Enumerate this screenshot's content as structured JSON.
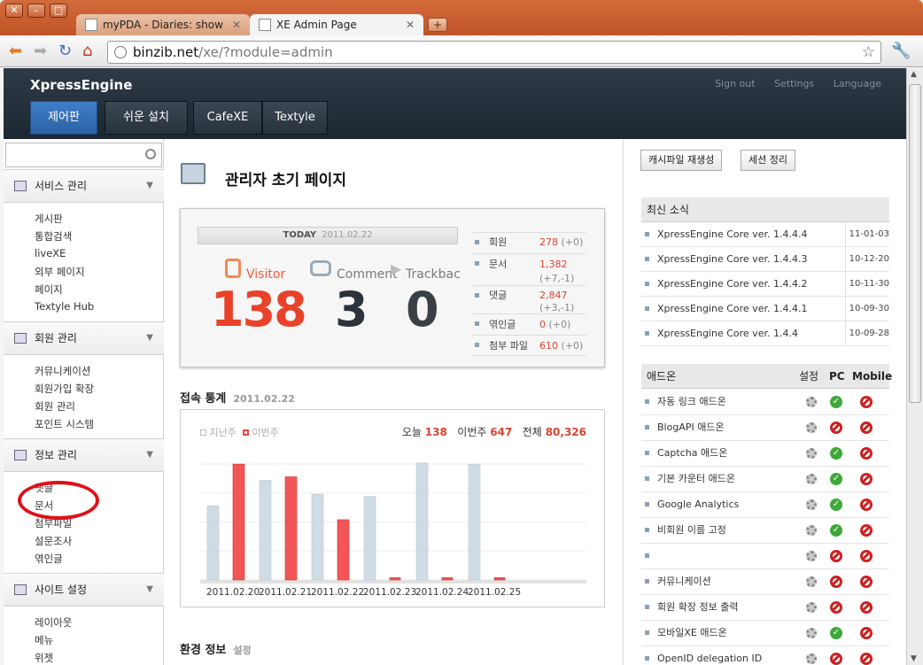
{
  "window": {
    "tabs": [
      {
        "label": "myPDA - Diaries: show"
      },
      {
        "label": "XE Admin Page"
      }
    ],
    "new_tab": "+",
    "url_host": "binzib.net",
    "url_path": "/xe/?module=admin"
  },
  "header": {
    "brand": "XpressEngine",
    "links": [
      "Sign out",
      "Settings",
      "Language"
    ],
    "menu": [
      "제어판",
      "쉬운 설치",
      "CafeXE",
      "Textyle"
    ]
  },
  "sidebar": {
    "sections": [
      {
        "title": "서비스 관리",
        "items": [
          "게시판",
          "통합검색",
          "liveXE",
          "외부 페이지",
          "페이지",
          "Textyle Hub"
        ]
      },
      {
        "title": "회원 관리",
        "items": [
          "커뮤니케이션",
          "회원가입 확장",
          "회원 관리",
          "포인트 시스템"
        ]
      },
      {
        "title": "정보 관리",
        "items": [
          "댓글",
          "문서",
          "첨부파일",
          "설문조사",
          "엮인글"
        ]
      },
      {
        "title": "사이트 설정",
        "items": [
          "레이아웃",
          "메뉴",
          "위젯"
        ]
      }
    ]
  },
  "main": {
    "title": "관리자 초기 페이지",
    "today": {
      "label": "TODAY",
      "date": "2011.02.22"
    },
    "counters": [
      {
        "label": "Visitor",
        "value": "138"
      },
      {
        "label": "Comment",
        "value": "3"
      },
      {
        "label": "Trackbac",
        "value": "0"
      }
    ],
    "stats": [
      {
        "label": "회원",
        "value": "278",
        "delta": "(+0)"
      },
      {
        "label": "문서",
        "value": "1,382",
        "delta": "(+7,-1)"
      },
      {
        "label": "댓글",
        "value": "2,847",
        "delta": "(+3,-1)"
      },
      {
        "label": "엮인글",
        "value": "0",
        "delta": "(+0)"
      },
      {
        "label": "첨부 파일",
        "value": "610",
        "delta": "(+0)"
      }
    ],
    "traffic_title": "접속 통계",
    "traffic_date": "2011.02.22",
    "env_title": "환경 정보",
    "env_link": "설정"
  },
  "chart_data": {
    "type": "bar",
    "categories": [
      "2011.02.20",
      "2011.02.21",
      "2011.02.22",
      "2011.02.23",
      "2011.02.24",
      "2011.02.25"
    ],
    "series": [
      {
        "name": "지난주",
        "values": [
          64,
          86,
          74,
          72,
          101,
          100
        ]
      },
      {
        "name": "이번주",
        "values": [
          100,
          89,
          52,
          2,
          2,
          2
        ]
      }
    ],
    "legend": [
      "지난주",
      "이번주"
    ],
    "summary": [
      {
        "label": "오늘",
        "value": "138"
      },
      {
        "label": "이번주",
        "value": "647"
      },
      {
        "label": "전체",
        "value": "80,326"
      }
    ],
    "ylim": [
      0,
      110
    ],
    "grid": true,
    "colors": {
      "last_week": "#cfdce4",
      "this_week": "#f25656"
    }
  },
  "right": {
    "buttons": [
      "캐시파일 재생성",
      "세션 정리"
    ],
    "news_title": "최신 소식",
    "news": [
      {
        "title": "XpressEngine Core ver. 1.4.4.4",
        "date": "11-01-03"
      },
      {
        "title": "XpressEngine Core ver. 1.4.4.3",
        "date": "10-12-20"
      },
      {
        "title": "XpressEngine Core ver. 1.4.4.2",
        "date": "10-11-30"
      },
      {
        "title": "XpressEngine Core ver. 1.4.4.1",
        "date": "10-09-30"
      },
      {
        "title": "XpressEngine Core ver. 1.4.4",
        "date": "10-09-28"
      }
    ],
    "addon_header": {
      "title": "애드온",
      "setting": "설정",
      "pc": "PC",
      "mobile": "Mobile"
    },
    "addons": [
      {
        "name": "자동 링크 애드온",
        "pc": true,
        "mobile": false
      },
      {
        "name": "BlogAPI 애드온",
        "pc": false,
        "mobile": false
      },
      {
        "name": "Captcha 애드온",
        "pc": true,
        "mobile": false
      },
      {
        "name": "기본 카운터 애드온",
        "pc": true,
        "mobile": false
      },
      {
        "name": "Google Analytics",
        "pc": true,
        "mobile": false
      },
      {
        "name": "비회원 이름 고정",
        "pc": true,
        "mobile": false
      },
      {
        "name": "",
        "pc": false,
        "mobile": false
      },
      {
        "name": "커뮤니케이션",
        "pc": false,
        "mobile": false
      },
      {
        "name": "회원 확장 정보 출력",
        "pc": false,
        "mobile": false
      },
      {
        "name": "모바일XE 애드온",
        "pc": true,
        "mobile": false
      },
      {
        "name": "OpenID delegation ID",
        "pc": false,
        "mobile": false
      }
    ]
  }
}
